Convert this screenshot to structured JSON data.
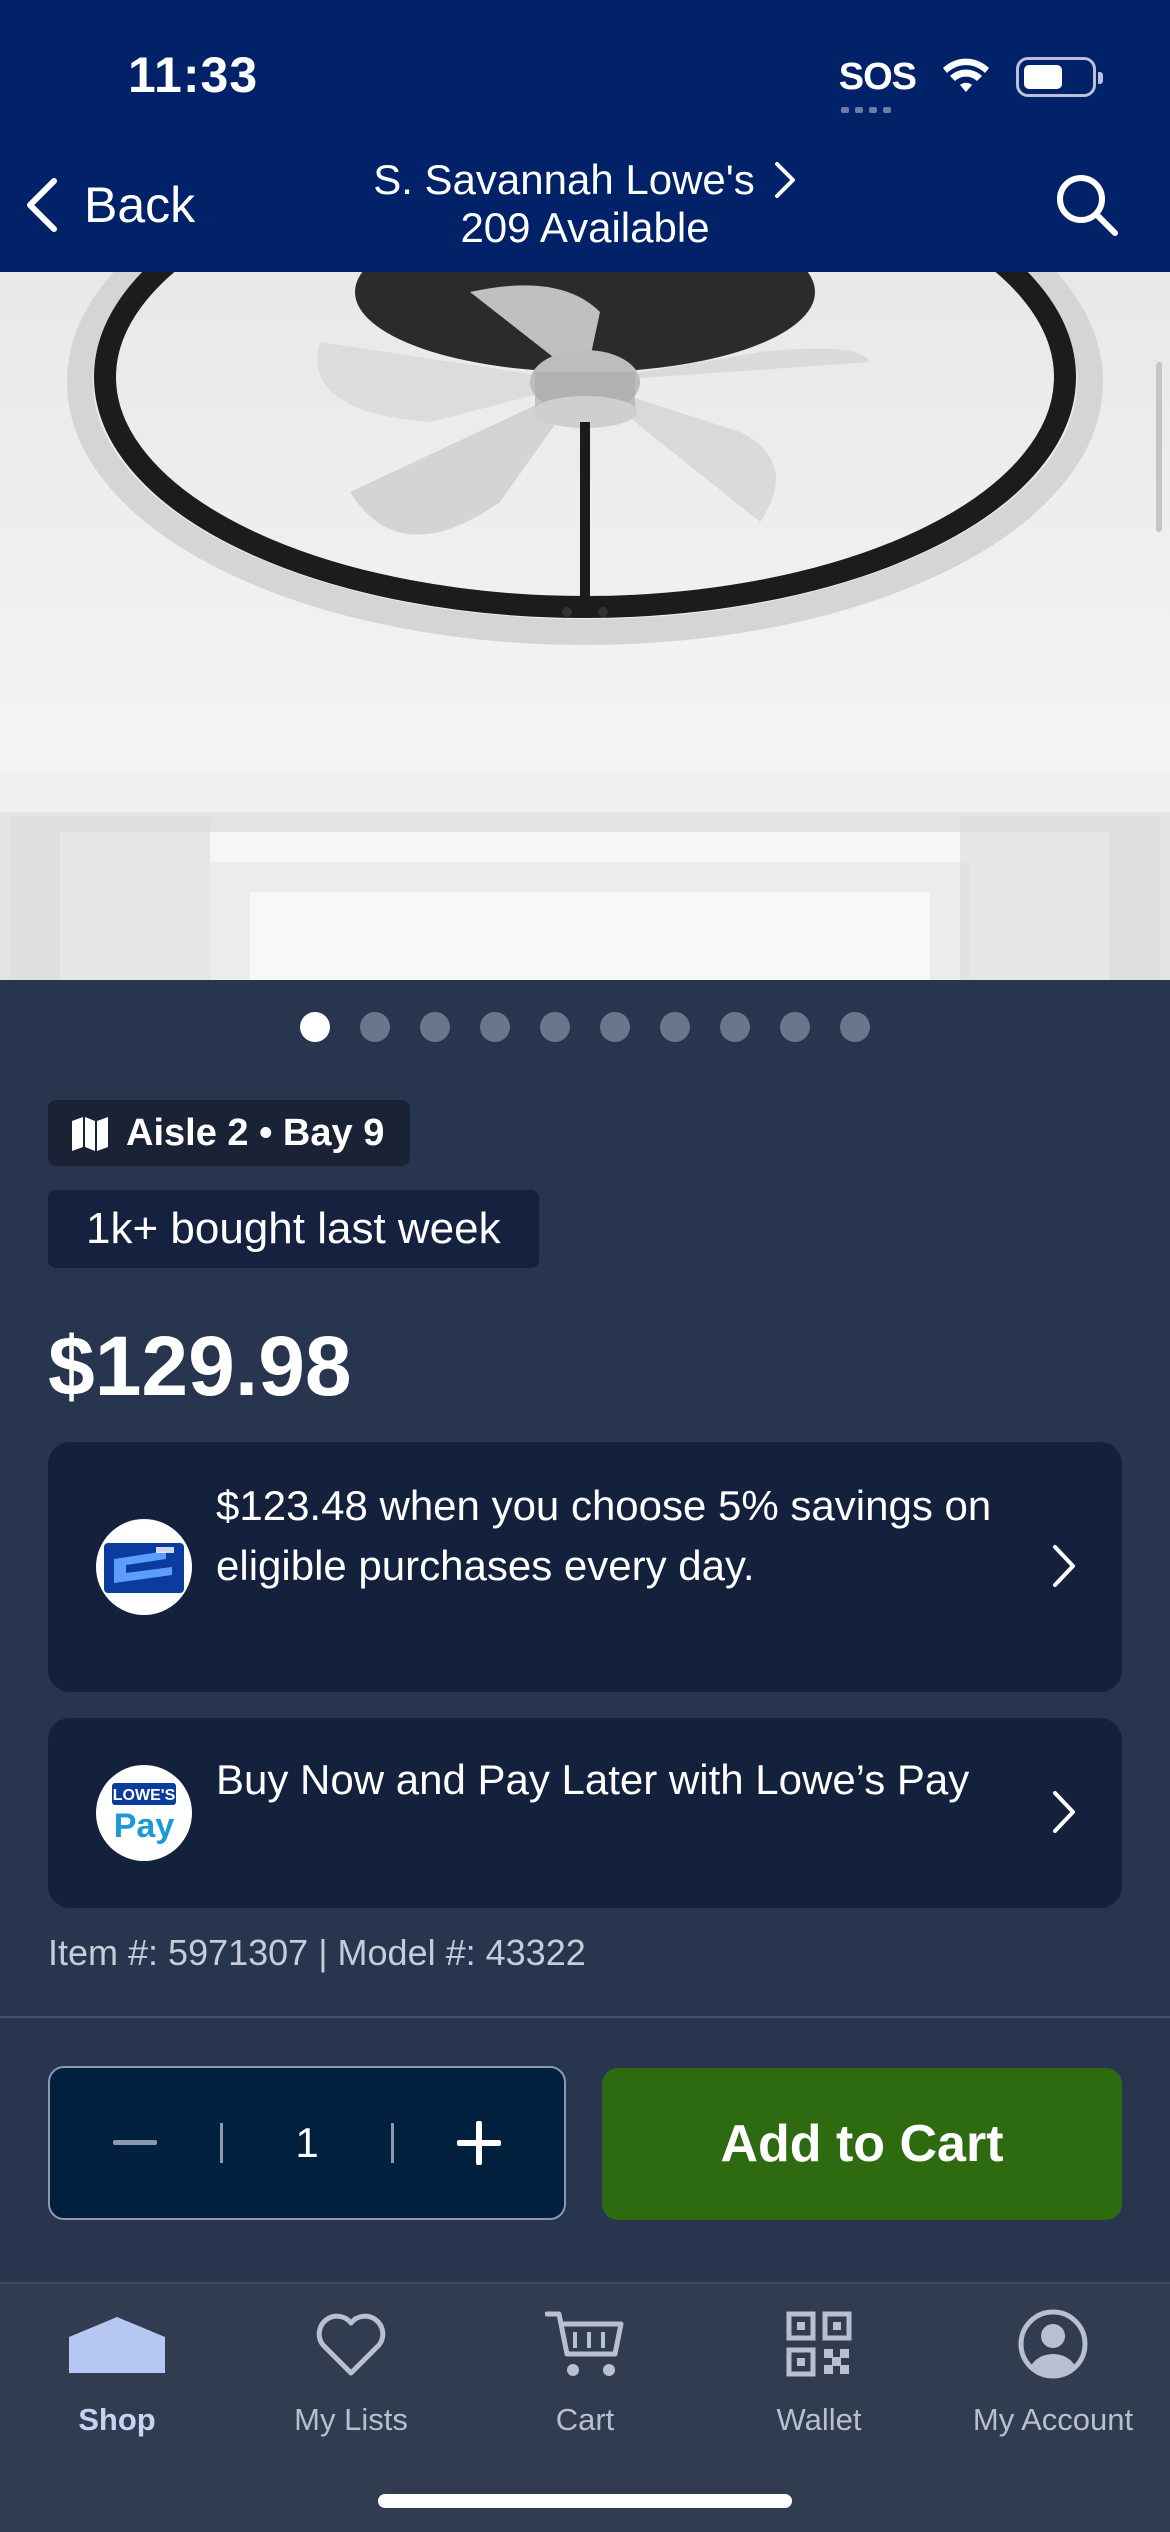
{
  "status_bar": {
    "time": "11:33",
    "sos": "SOS"
  },
  "header": {
    "back_label": "Back",
    "store_name": "S. Savannah Lowe's",
    "availability": "209 Available"
  },
  "carousel": {
    "count": 10,
    "active_index": 0
  },
  "product": {
    "aisle_location": "Aisle 2 • Bay 9",
    "bought_badge": "1k+ bought last week",
    "price": "$129.98",
    "item_info": "Item #: 5971307 | Model #: 43322"
  },
  "promos": [
    {
      "text": "$123.48 when you choose 5% savings on eligible purchases every day."
    },
    {
      "text": "Buy Now and Pay Later with Lowe’s Pay",
      "logo_text_top": "LOWE'S",
      "logo_text_bottom": "Pay"
    }
  ],
  "purchase": {
    "quantity": "1",
    "add_to_cart_label": "Add to Cart"
  },
  "tab_bar": {
    "tabs": [
      {
        "label": "Shop",
        "icon": "house-icon",
        "active": true
      },
      {
        "label": "My Lists",
        "icon": "heart-icon",
        "active": false
      },
      {
        "label": "Cart",
        "icon": "cart-icon",
        "active": false
      },
      {
        "label": "Wallet",
        "icon": "qr-code-icon",
        "active": false
      },
      {
        "label": "My Account",
        "icon": "account-icon",
        "active": false
      }
    ]
  },
  "colors": {
    "header_bg": "#012169",
    "page_bg": "#27354f",
    "card_bg": "#14213d",
    "add_to_cart": "#2e6a10",
    "tab_bar_bg": "#313c51"
  }
}
